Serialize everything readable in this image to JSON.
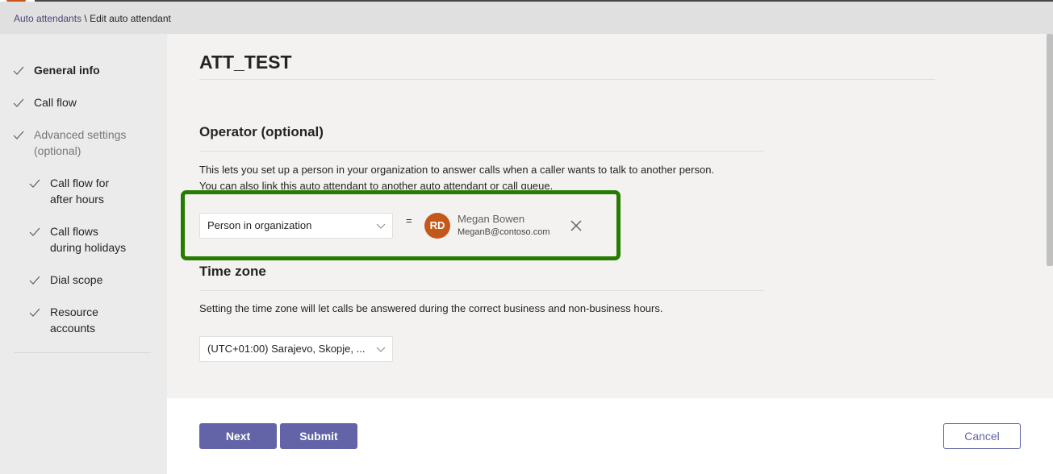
{
  "breadcrumb": {
    "parent": "Auto attendants",
    "separator": " \\ ",
    "current": "Edit auto attendant"
  },
  "sidebar": {
    "items": [
      {
        "label": "General info",
        "checked": true
      },
      {
        "label": "Call flow",
        "checked": true
      },
      {
        "label": "Advanced settings",
        "label2": "(optional)",
        "checked": true
      },
      {
        "label": "Call flow for",
        "label2": "after hours",
        "checked": true
      },
      {
        "label": "Call flows",
        "label2": "during holidays",
        "checked": true
      },
      {
        "label": "Dial scope",
        "checked": true
      },
      {
        "label": "Resource",
        "label2": "accounts",
        "checked": true
      }
    ]
  },
  "main": {
    "title": "ATT_TEST",
    "operator": {
      "title": "Operator (optional)",
      "desc_line1": "This lets you set up a person in your organization to answer calls when a caller wants to talk to another person.",
      "desc_line2": "You can also link this auto attendant to another auto attendant or call queue.",
      "type_selected": "Person in organization",
      "equals": "=",
      "person": {
        "initials": "RD",
        "name": "Megan Bowen",
        "email": "MeganB@contoso.com"
      }
    },
    "timezone": {
      "title": "Time zone",
      "desc": "Setting the time zone will let calls be answered during the correct business and non-business hours.",
      "selected": "(UTC+01:00) Sarajevo, Skopje, ..."
    }
  },
  "footer": {
    "next_label": "Next",
    "submit_label": "Submit",
    "cancel_label": "Cancel"
  },
  "colors": {
    "accent": "#6264a7",
    "highlight": "#267c00",
    "avatar": "#c4581b"
  }
}
